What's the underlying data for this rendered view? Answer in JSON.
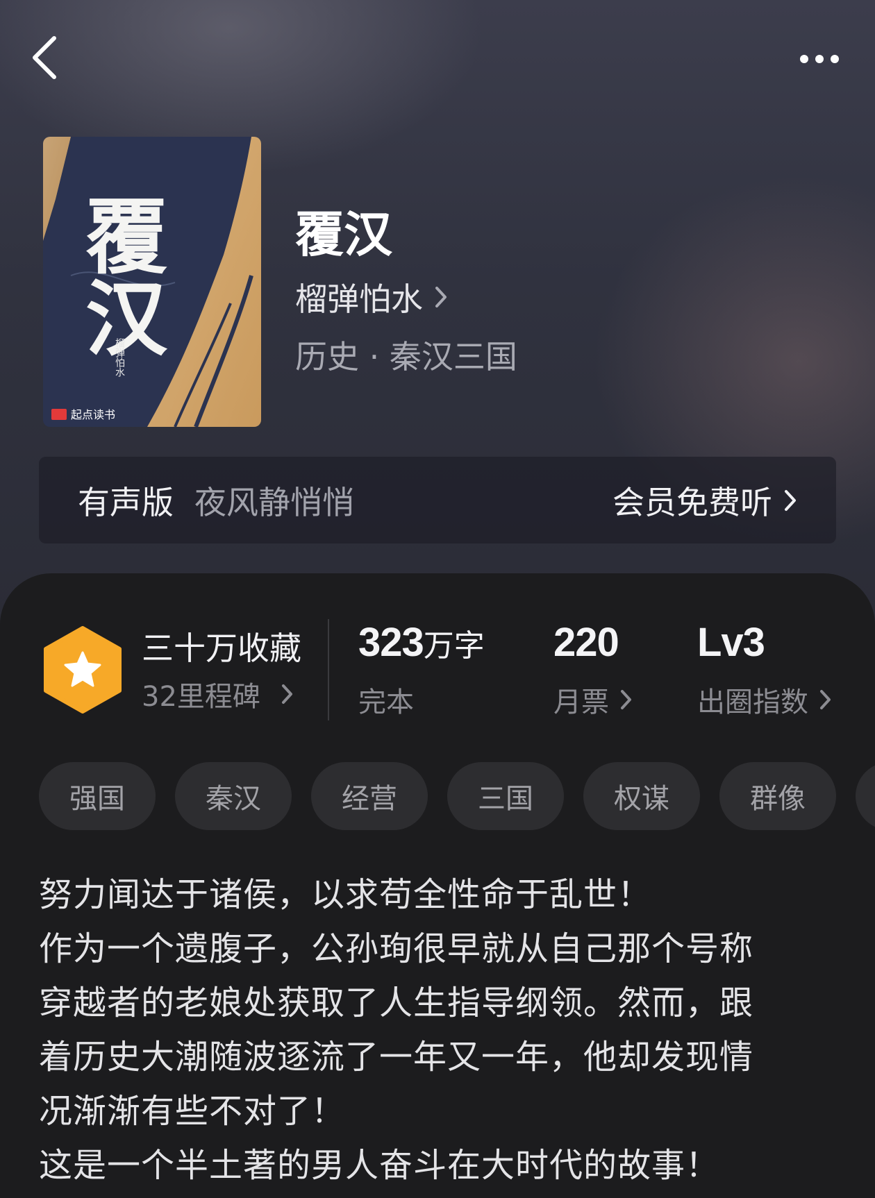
{
  "book": {
    "title": "覆汉",
    "author": "榴弹怕水",
    "category": "历史 · 秦汉三国"
  },
  "cover": {
    "title_text": "覆汉",
    "author_text": "榴弹怕水",
    "publisher_text": "起点读书"
  },
  "audio": {
    "label": "有声版",
    "narrator": "夜风静悄悄",
    "action": "会员免费听"
  },
  "stats": {
    "collections": "三十万收藏",
    "milestone": "32里程碑",
    "word_count": "323",
    "word_unit": "万字",
    "status": "完本",
    "monthly_tickets": "220",
    "monthly_tickets_label": "月票",
    "influence": "Lv3",
    "influence_label": "出圈指数"
  },
  "tags": [
    "强国",
    "秦汉",
    "经营",
    "三国",
    "权谋",
    "群像"
  ],
  "synopsis": [
    "努力闻达于诸侯，以求苟全性命于乱世！",
    "作为一个遗腹子，公孙珣很早就从自己那个号称",
    "穿越者的老娘处获取了人生指导纲领。然而，跟",
    "着历史大潮随波逐流了一年又一年，他却发现情",
    "况渐渐有些不对了！",
    "这是一个半土著的男人奋斗在大时代的故事！"
  ],
  "colors": {
    "badge_orange": "#f7a928",
    "panel_bg": "#1c1c1e",
    "tag_bg": "#2d2d30"
  }
}
